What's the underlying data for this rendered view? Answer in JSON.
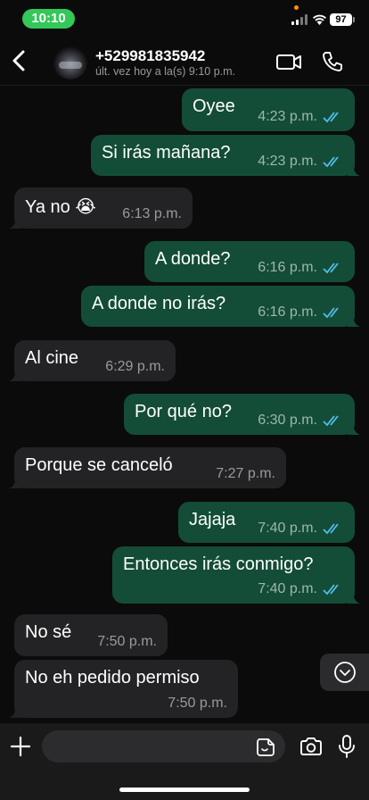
{
  "status_bar": {
    "time": "10:10",
    "battery": "97"
  },
  "header": {
    "contact": "+529981835942",
    "last_seen": "últ. vez hoy a la(s) 9:10 p.m."
  },
  "colors": {
    "outgoing_bubble": "#134d37",
    "incoming_bubble": "#232325",
    "read_ticks": "#53bdeb",
    "time_pill": "#34c759"
  },
  "messages": [
    {
      "dir": "out",
      "text": "Oyee",
      "time": "4:23 p.m.",
      "read": true
    },
    {
      "dir": "out",
      "text": "Si irás mañana?",
      "time": "4:23 p.m.",
      "read": true
    },
    {
      "dir": "in",
      "text": "Ya no 😭",
      "time": "6:13 p.m."
    },
    {
      "dir": "out",
      "text": "A donde?",
      "time": "6:16 p.m.",
      "read": true
    },
    {
      "dir": "out",
      "text": "A donde no irás?",
      "time": "6:16 p.m.",
      "read": true
    },
    {
      "dir": "in",
      "text": "Al cine",
      "time": "6:29 p.m."
    },
    {
      "dir": "out",
      "text": "Por qué no?",
      "time": "6:30 p.m.",
      "read": true
    },
    {
      "dir": "in",
      "text": "Porque se canceló",
      "time": "7:27 p.m."
    },
    {
      "dir": "out",
      "text": "Jajaja",
      "time": "7:40 p.m.",
      "read": true
    },
    {
      "dir": "out",
      "text": "Entonces irás conmigo?",
      "time": "7:40 p.m.",
      "read": true
    },
    {
      "dir": "in",
      "text": "No sé",
      "time": "7:50 p.m."
    },
    {
      "dir": "in",
      "text": "No eh pedido permiso",
      "time": "7:50 p.m."
    }
  ],
  "icons": {
    "back": "chevron-left-icon",
    "video": "video-camera-icon",
    "call": "phone-icon",
    "scroll": "chevron-down-circle-icon",
    "attach": "plus-icon",
    "sticker": "sticker-icon",
    "camera": "camera-icon",
    "mic": "microphone-icon"
  }
}
